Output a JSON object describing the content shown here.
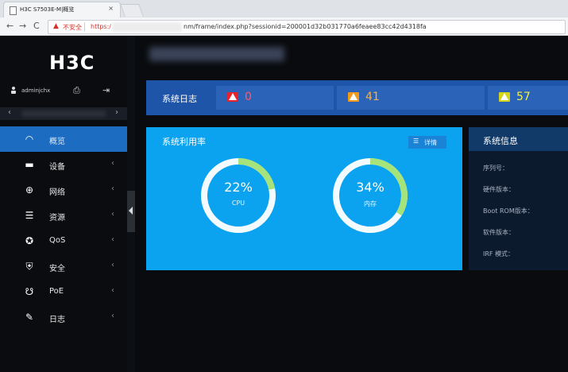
{
  "browser": {
    "tab_title": "H3C S7503E-M|概览",
    "tab_close": "×",
    "back": "←",
    "forward": "→",
    "reload": "C",
    "security_warning": "不安全",
    "url_protocol": "https:/",
    "url_path": "nm/frame/index.php?sessionid=200001d32b031770a6feaee83cc42d4318fa"
  },
  "sidebar": {
    "logo": "H3C",
    "username": "adminjchx",
    "collapse_left": "‹",
    "collapse_right": "›",
    "items": [
      {
        "label": "概览",
        "icon": "dashboard-icon",
        "glyph": "◠",
        "chevron": "",
        "active": true
      },
      {
        "label": "设备",
        "icon": "device-icon",
        "glyph": "▬",
        "chevron": "‹",
        "active": false
      },
      {
        "label": "网络",
        "icon": "network-globe-icon",
        "glyph": "⊕",
        "chevron": "‹",
        "active": false
      },
      {
        "label": "资源",
        "icon": "resource-database-icon",
        "glyph": "☰",
        "chevron": "‹",
        "active": false
      },
      {
        "label": "QoS",
        "icon": "qos-icon",
        "glyph": "✪",
        "chevron": "‹",
        "active": false
      },
      {
        "label": "安全",
        "icon": "security-shield-icon",
        "glyph": "⛨",
        "chevron": "‹",
        "active": false
      },
      {
        "label": "PoE",
        "icon": "poe-icon",
        "glyph": "☋",
        "chevron": "‹",
        "active": false
      },
      {
        "label": "日志",
        "icon": "log-icon",
        "glyph": "✎",
        "chevron": "‹",
        "active": false
      }
    ]
  },
  "log_summary": {
    "title": "系统日志",
    "items": [
      {
        "count": "0",
        "color": "#e8212e",
        "text_color": "#ff5a64"
      },
      {
        "count": "41",
        "color": "#f39a1c",
        "text_color": "#ffb13a"
      },
      {
        "count": "57",
        "color": "#d4d41a",
        "text_color": "#f2f245"
      }
    ]
  },
  "usage": {
    "title": "系统利用率",
    "detail_label": "详情",
    "cpu": {
      "value": "22%",
      "label": "CPU",
      "fraction": 0.22
    },
    "memory": {
      "value": "34%",
      "label": "内存",
      "fraction": 0.34
    }
  },
  "system_info": {
    "title": "系统信息",
    "rows": [
      "序列号：",
      "硬件版本：",
      "Boot ROM版本：",
      "软件版本：",
      "IRF 模式："
    ]
  },
  "colors": {
    "active_menu": "#1c6dc1",
    "usage_panel": "#0ba2ef",
    "gauge_track": "#f4fbff",
    "gauge_fill": "#a6e37a"
  }
}
